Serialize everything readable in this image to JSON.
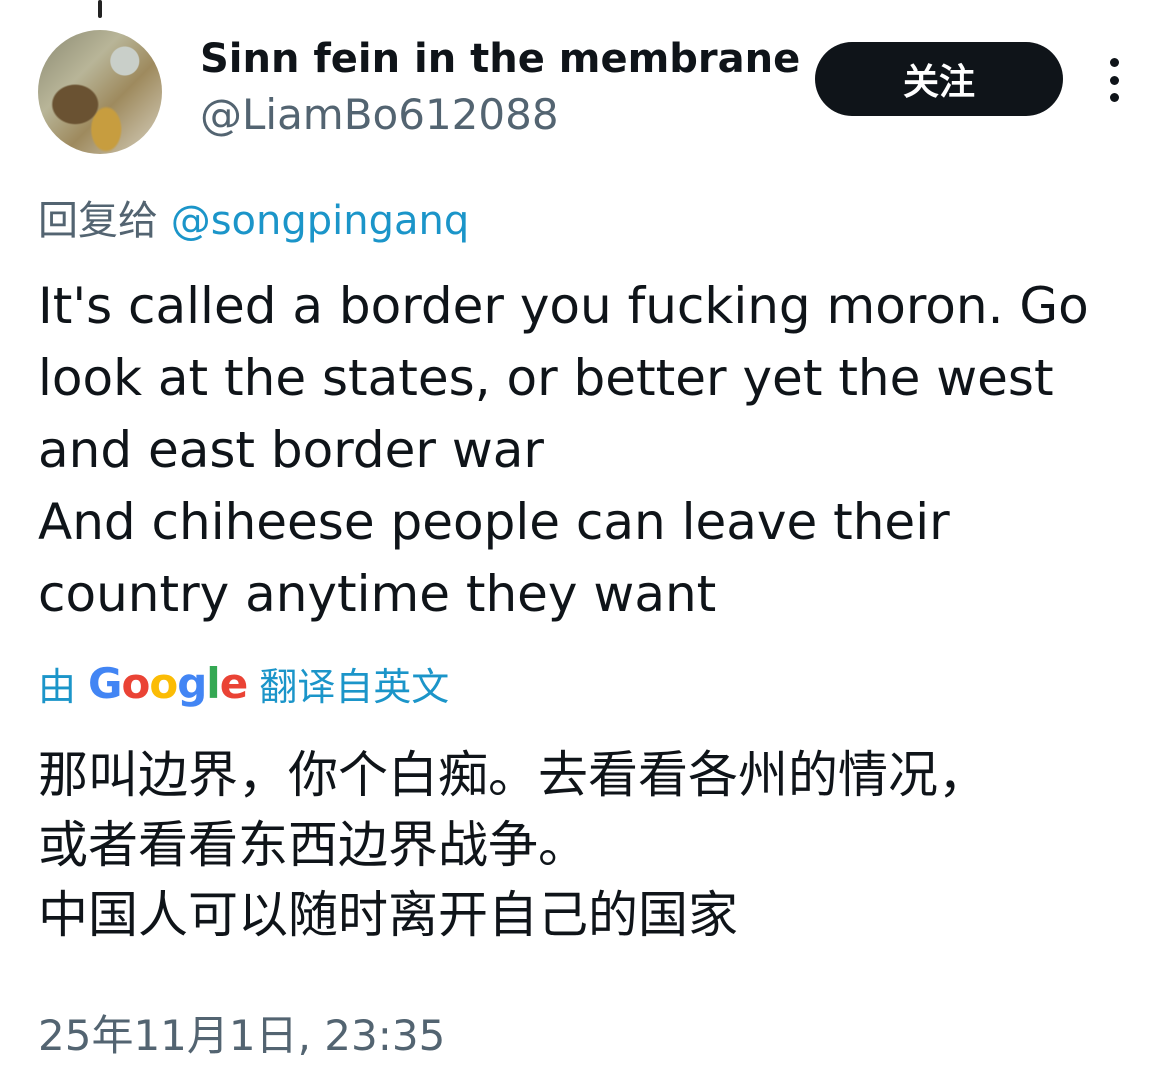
{
  "author": {
    "display_name": "Sinn fein in the membrane",
    "handle": "@LiamBo612088"
  },
  "follow_label": "关注",
  "reply": {
    "prefix": "回复给",
    "mention": "@songpinganq"
  },
  "tweet_lines": [
    "It's called a border you fucking moron. Go",
    "look at the states, or better yet the west",
    "and east border war",
    "And chiheese people can leave their",
    "country anytime they want"
  ],
  "translation": {
    "prefix": "由",
    "provider": "Google",
    "suffix": "翻译自英文"
  },
  "translated_lines": [
    "那叫边界，你个白痴。去看看各州的情况，",
    "或者看看东西边界战争。",
    "中国人可以随时离开自己的国家"
  ],
  "timestamp": "25年11月1日, 23:35",
  "icons": {
    "more": "more-vertical-icon",
    "avatar": "avatar-image"
  }
}
